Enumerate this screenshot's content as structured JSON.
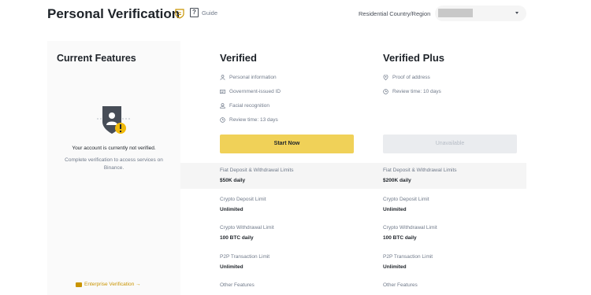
{
  "header": {
    "title": "Personal Verification",
    "guide_label": "Guide",
    "country_label": "Residential Country/Region"
  },
  "current_features": {
    "title": "Current Features",
    "status": "Your account is currently not verified.",
    "description": "Complete verification to access services on Binance.",
    "enterprise_link": "Enterprise Verification →"
  },
  "verified": {
    "title": "Verified",
    "features": [
      {
        "icon": "person-icon",
        "label": "Personal information"
      },
      {
        "icon": "id-card-icon",
        "label": "Government-issued ID"
      },
      {
        "icon": "face-icon",
        "label": "Facial recognition"
      },
      {
        "icon": "clock-icon",
        "label": "Review time: 13 days"
      }
    ],
    "button_label": "Start Now",
    "limits": [
      {
        "label": "Fiat Deposit & Withdrawal Limits",
        "value": "$50K daily"
      },
      {
        "label": "Crypto Deposit Limit",
        "value": "Unlimited"
      },
      {
        "label": "Crypto Withdrawal Limit",
        "value": "100 BTC daily"
      },
      {
        "label": "P2P Transaction Limit",
        "value": "Unlimited"
      },
      {
        "label": "Other Features",
        "value": ""
      }
    ]
  },
  "verified_plus": {
    "title": "Verified Plus",
    "features": [
      {
        "icon": "location-pin-icon",
        "label": "Proof of address"
      },
      {
        "icon": "clock-icon",
        "label": "Review time: 10 days"
      }
    ],
    "button_label": "Unavailable",
    "limits": [
      {
        "label": "Fiat Deposit & Withdrawal Limits",
        "value": "$200K daily"
      },
      {
        "label": "Crypto Deposit Limit",
        "value": "Unlimited"
      },
      {
        "label": "Crypto Withdrawal Limit",
        "value": "100 BTC daily"
      },
      {
        "label": "P2P Transaction Limit",
        "value": "Unlimited"
      },
      {
        "label": "Other Features",
        "value": ""
      }
    ]
  },
  "colors": {
    "accent": "#f0b90b",
    "primary_button": "#f0d158",
    "disabled_button": "#eaecef",
    "sidebar_bg": "#fafafa",
    "link": "#c99400"
  }
}
